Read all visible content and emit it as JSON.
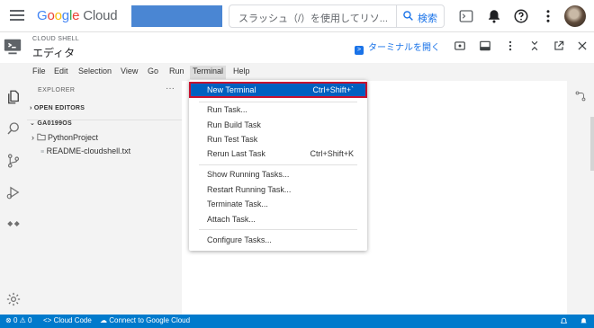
{
  "topbar": {
    "logo_parts": [
      "G",
      "o",
      "o",
      "g",
      "l",
      "e"
    ],
    "logo_cloud": "Cloud",
    "search_placeholder": "スラッシュ（/）を使用してリソ...",
    "search_button": "検索",
    "icons": [
      "menu-icon",
      "terminal-icon",
      "bell-icon",
      "help-icon",
      "more-vert-icon"
    ],
    "project_color": "#4a86d3"
  },
  "shell": {
    "label": "CLOUD SHELL",
    "title": "エディタ",
    "open_terminal": "ターミナルを開く",
    "icons": [
      "preview-icon",
      "layout-icon",
      "more-vert-icon",
      "minimize-icon",
      "open-new-window-icon",
      "close-icon"
    ]
  },
  "menubar": {
    "items": [
      "File",
      "Edit",
      "Selection",
      "View",
      "Go",
      "Run",
      "Terminal",
      "Help"
    ],
    "active": "Terminal"
  },
  "explorer": {
    "title": "EXPLORER",
    "more": "···",
    "open_editors": "OPEN EDITORS",
    "workspace": "GA0199OS",
    "folder": "PythonProject",
    "file": "README-cloudshell.txt"
  },
  "terminal_menu": {
    "items": [
      {
        "label": "New Terminal",
        "key": "Ctrl+Shift+`",
        "selected": true
      },
      {
        "label": "Run Task...",
        "key": ""
      },
      {
        "label": "Run Build Task",
        "key": ""
      },
      {
        "label": "Run Test Task",
        "key": ""
      },
      {
        "label": "Rerun Last Task",
        "key": "Ctrl+Shift+K"
      },
      {
        "label": "Show Running Tasks...",
        "key": ""
      },
      {
        "label": "Restart Running Task...",
        "key": ""
      },
      {
        "label": "Terminate Task...",
        "key": ""
      },
      {
        "label": "Attach Task...",
        "key": ""
      },
      {
        "label": "Configure Tasks...",
        "key": ""
      }
    ]
  },
  "statusbar": {
    "errors": "0",
    "warnings": "0",
    "cloud_code": "Cloud Code",
    "connect": "Connect to Google Cloud"
  },
  "colors": {
    "accent": "#1a73e8",
    "status_bar": "#007acc",
    "selection": "#0060c0",
    "highlight_outline": "#c8102e"
  }
}
